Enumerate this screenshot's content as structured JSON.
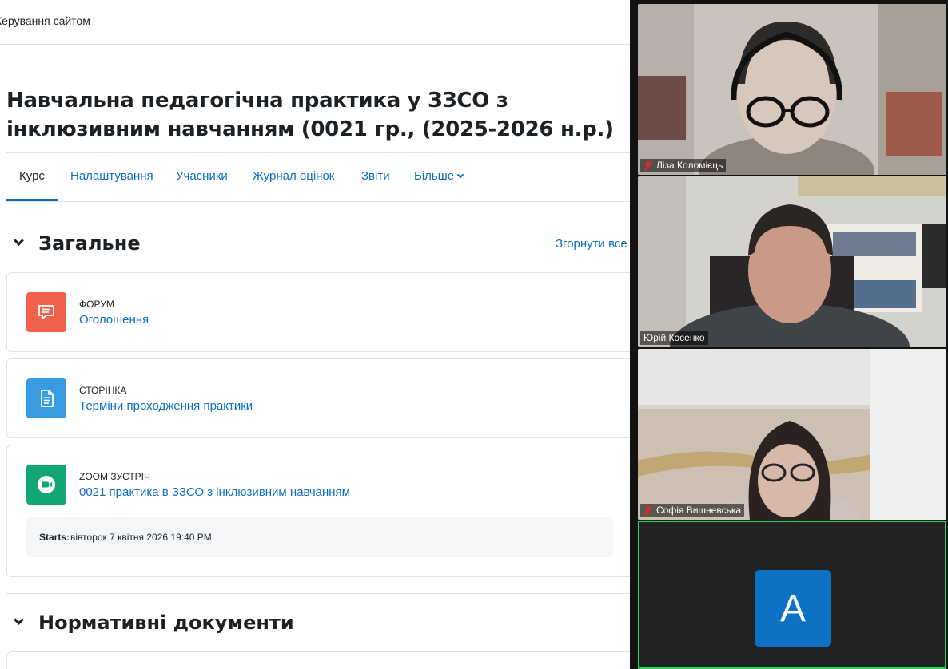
{
  "moodle": {
    "topbar_label": "Керування сайтом",
    "course_title": "Навчальна педагогічна практика у ЗЗСО з інклюзивним навчанням (0021 гр., (2025-2026 н.р.)",
    "tabs": [
      {
        "label": "Курс",
        "active": true
      },
      {
        "label": "Налаштування"
      },
      {
        "label": "Учасники"
      },
      {
        "label": "Журнал оцінок"
      },
      {
        "label": "Звіти"
      },
      {
        "label": "Більше"
      }
    ],
    "collapse_all": "Згорнути все",
    "sections": [
      {
        "title": "Загальне",
        "activities": [
          {
            "type": "ФОРУМ",
            "name": "Оголошення",
            "icon": "forum-icon",
            "color": "#f0624c"
          },
          {
            "type": "СТОРІНКА",
            "name": "Терміни проходження практики",
            "icon": "page-icon",
            "color": "#399be2"
          },
          {
            "type": "ZOOM ЗУСТРІЧ",
            "name": "0021 практика в ЗЗСО з інклюзивним навчанням",
            "icon": "zoom-video-icon",
            "color": "#11a676",
            "starts_label": "Starts:",
            "starts_value": "вівторок 7 квітня 2026 19:40 PM"
          }
        ]
      },
      {
        "title": "Нормативні документи"
      }
    ]
  },
  "zoom": {
    "participants": [
      {
        "name": "Ліза Коломієць",
        "muted": true
      },
      {
        "name": "Юрій Косенко",
        "muted": false
      },
      {
        "name": "Софія Вишневська",
        "muted": true
      },
      {
        "avatar_letter": "A",
        "active_speaker": true,
        "avatar_color": "#0e72c4",
        "border_color": "#23d959"
      }
    ]
  }
}
